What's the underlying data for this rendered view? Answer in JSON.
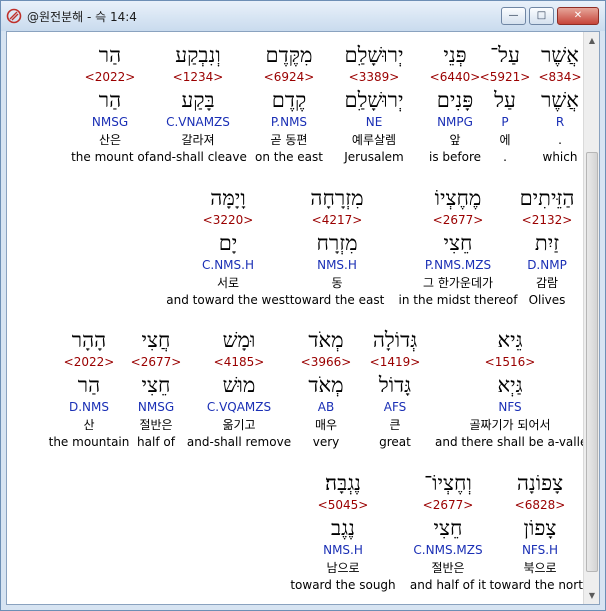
{
  "window": {
    "title": "@원전분해 - 슥 14:4",
    "minimize_glyph": "—",
    "maximize_glyph": "□",
    "close_glyph": "✕"
  },
  "rows": [
    {
      "words": [
        {
          "hebrew": "אֲשֶׁר",
          "strong": "<834>",
          "lemma": "אֲשֶׁר",
          "parse": "R",
          "korean": ".",
          "english": "which"
        },
        {
          "hebrew": "עַל־",
          "strong": "<5921>",
          "lemma": "עַל",
          "parse": "P",
          "korean": "에",
          "english": "."
        },
        {
          "hebrew": "פְּנֵי",
          "strong": "<6440>",
          "lemma": "פָּנִים",
          "parse": "NMPG",
          "korean": "앞",
          "english": "is before"
        },
        {
          "hebrew": "יְרוּשָׁלַ͏ִם",
          "strong": "<3389>",
          "lemma": "יְרוּשָׁלַ͏ִם",
          "parse": "NE",
          "korean": "예루살렘",
          "english": "Jerusalem"
        },
        {
          "hebrew": "מִקֶּדֶם",
          "strong": "<6924>",
          "lemma": "קֶדֶם",
          "parse": "P.NMS",
          "korean": "곧 동편",
          "english": "on the east"
        },
        {
          "hebrew": "וְנִבְקַע",
          "strong": "<1234>",
          "lemma": "בָּקַע",
          "parse": "C.VNAMZS",
          "korean": "갈라져",
          "english": "and-shall cleave"
        },
        {
          "hebrew": "הַר",
          "strong": "<2022>",
          "lemma": "הַר",
          "parse": "NMSG",
          "korean": "산은",
          "english": "the mount of"
        }
      ]
    },
    {
      "words": [
        {
          "hebrew": "הַזֵּיתִים",
          "strong": "<2132>",
          "lemma": "זַיִת",
          "parse": "D.NMP",
          "korean": "감람",
          "english": "Olives"
        },
        {
          "hebrew": "מֶחֶצְיוֹ",
          "strong": "<2677>",
          "lemma": "חֵצִי",
          "parse": "P.NMS.MZS",
          "korean": "그 한가운데가",
          "english": "in the midst thereof"
        },
        {
          "hebrew": "מִזְרָחָה",
          "strong": "<4217>",
          "lemma": "מִזְרָח",
          "parse": "NMS.H",
          "korean": "동",
          "english": "toward the east"
        },
        {
          "hebrew": "וָיָמָּה",
          "strong": "<3220>",
          "lemma": "יָם",
          "parse": "C.NMS.H",
          "korean": "서로",
          "english": "and toward the west"
        }
      ]
    },
    {
      "words": [
        {
          "hebrew": "גֵּיא",
          "strong": "<1516>",
          "lemma": "גַּיְא",
          "parse": "NFS",
          "korean": "골짜기가 되어서",
          "english": "and there shall be a-valley"
        },
        {
          "hebrew": "גְּדוֹלָה",
          "strong": "<1419>",
          "lemma": "גָּדוֹל",
          "parse": "AFS",
          "korean": "큰",
          "english": "great"
        },
        {
          "hebrew": "מְאֹד",
          "strong": "<3966>",
          "lemma": "מְאֹד",
          "parse": "AB",
          "korean": "매우",
          "english": "very"
        },
        {
          "hebrew": "וּמָשׁ",
          "strong": "<4185>",
          "lemma": "מוּשׁ",
          "parse": "C.VQAMZS",
          "korean": "옮기고",
          "english": "and-shall remove"
        },
        {
          "hebrew": "חֲצִי",
          "strong": "<2677>",
          "lemma": "חֵצִי",
          "parse": "NMSG",
          "korean": "절반은",
          "english": "half of"
        },
        {
          "hebrew": "הָהָר",
          "strong": "<2022>",
          "lemma": "הַר",
          "parse": "D.NMS",
          "korean": "산",
          "english": "the mountain"
        }
      ]
    },
    {
      "words": [
        {
          "hebrew": "צָפוֹנָה",
          "strong": "<6828>",
          "lemma": "צָפוֹן",
          "parse": "NFS.H",
          "korean": "북으로",
          "english": "toward the north"
        },
        {
          "hebrew": "וְחֶצְיוֹ־",
          "strong": "<2677>",
          "lemma": "חֵצִי",
          "parse": "C.NMS.MZS",
          "korean": "절반은",
          "english": "and half of it"
        },
        {
          "hebrew": "נֶגְבָּה׃",
          "strong": "<5045>",
          "lemma": "נֶגֶב",
          "parse": "NMS.H",
          "korean": "남으로",
          "english": "toward the sough"
        }
      ]
    }
  ]
}
